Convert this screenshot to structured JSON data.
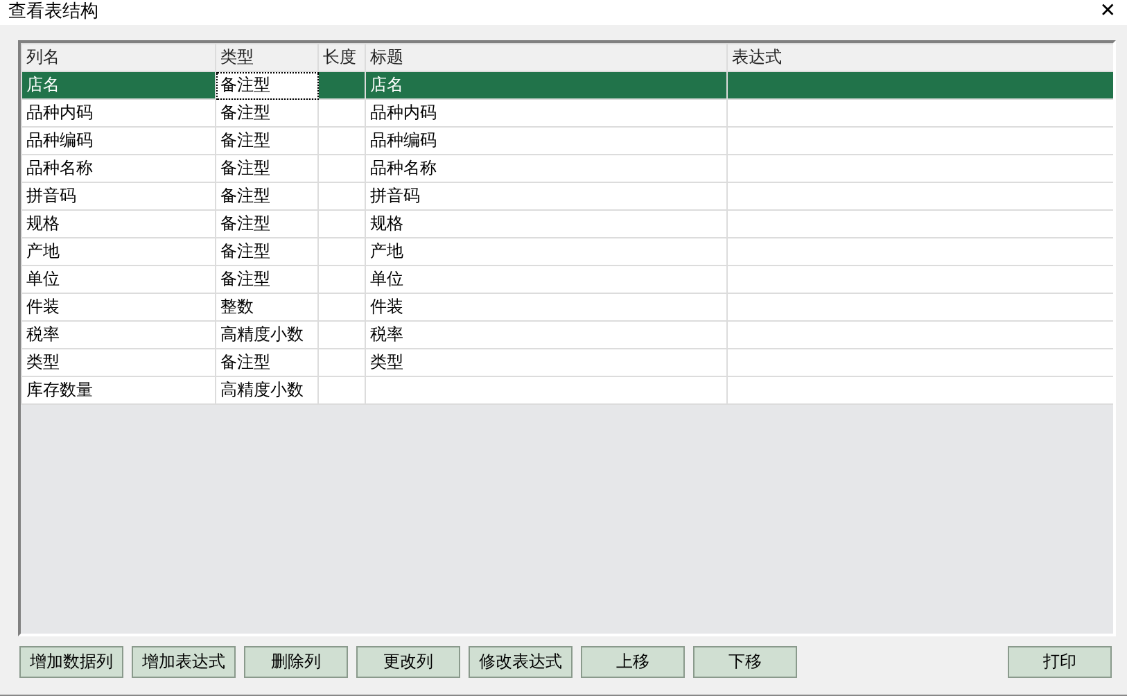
{
  "window": {
    "title": "查看表结构",
    "close": "✕"
  },
  "table": {
    "columns": [
      {
        "label": "列名",
        "current": false
      },
      {
        "label": "类型",
        "current": true
      },
      {
        "label": "长度",
        "current": false
      },
      {
        "label": "标题",
        "current": false
      },
      {
        "label": "表达式",
        "current": false
      }
    ],
    "rows": [
      {
        "cells": [
          "店名",
          "备注型",
          "",
          "店名",
          ""
        ],
        "selected": true
      },
      {
        "cells": [
          "品种内码",
          "备注型",
          "",
          "品种内码",
          ""
        ],
        "selected": false
      },
      {
        "cells": [
          "品种编码",
          "备注型",
          "",
          "品种编码",
          ""
        ],
        "selected": false
      },
      {
        "cells": [
          "品种名称",
          "备注型",
          "",
          "品种名称",
          ""
        ],
        "selected": false
      },
      {
        "cells": [
          "拼音码",
          "备注型",
          "",
          "拼音码",
          ""
        ],
        "selected": false
      },
      {
        "cells": [
          "规格",
          "备注型",
          "",
          "规格",
          ""
        ],
        "selected": false
      },
      {
        "cells": [
          "产地",
          "备注型",
          "",
          "产地",
          ""
        ],
        "selected": false
      },
      {
        "cells": [
          "单位",
          "备注型",
          "",
          "单位",
          ""
        ],
        "selected": false
      },
      {
        "cells": [
          "件装",
          "整数",
          "",
          "件装",
          ""
        ],
        "selected": false
      },
      {
        "cells": [
          "税率",
          "高精度小数",
          "",
          "税率",
          ""
        ],
        "selected": false
      },
      {
        "cells": [
          "类型",
          "备注型",
          "",
          "类型",
          ""
        ],
        "selected": false
      },
      {
        "cells": [
          "库存数量",
          "高精度小数",
          "",
          "",
          ""
        ],
        "selected": false
      }
    ]
  },
  "buttons": [
    "增加数据列",
    "增加表达式",
    "删除列",
    "更改列",
    "修改表达式",
    "上移",
    "下移"
  ],
  "right_buttons": [
    "打印"
  ]
}
